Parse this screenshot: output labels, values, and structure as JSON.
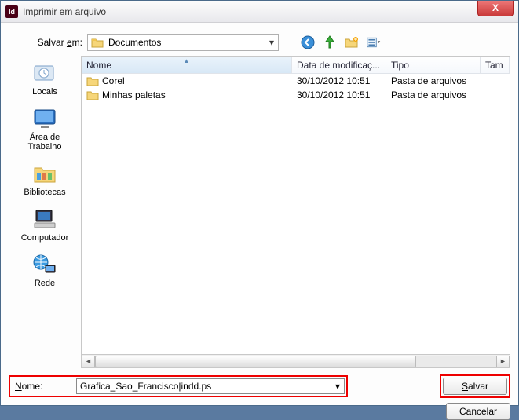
{
  "titlebar": {
    "app_badge": "Id",
    "title": "Imprimir em arquivo",
    "close": "X"
  },
  "toprow": {
    "savein_label_pre": "Salvar ",
    "savein_label_u": "e",
    "savein_label_post": "m:",
    "location": "Documentos"
  },
  "places": [
    {
      "label": "Locais"
    },
    {
      "label": "Área de Trabalho"
    },
    {
      "label": "Bibliotecas"
    },
    {
      "label": "Computador"
    },
    {
      "label": "Rede"
    }
  ],
  "columns": {
    "name": "Nome",
    "date": "Data de modificaç...",
    "type": "Tipo",
    "size": "Tam"
  },
  "rows": [
    {
      "name": "Corel",
      "date": "30/10/2012 10:51",
      "type": "Pasta de arquivos"
    },
    {
      "name": "Minhas paletas",
      "date": "30/10/2012 10:51",
      "type": "Pasta de arquivos"
    }
  ],
  "bottom": {
    "name_label_u": "N",
    "name_label_post": "ome:",
    "filename": "Grafica_Sao_Francisco|indd.ps",
    "save_u": "S",
    "save_post": "alvar",
    "cancel": "Cancelar"
  }
}
